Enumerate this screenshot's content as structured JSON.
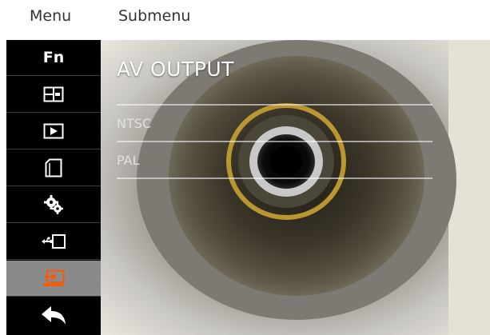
{
  "header": {
    "menu_label": "Menu",
    "submenu_label": "Submenu"
  },
  "sidebar": {
    "fn_label": "Fn",
    "items": [
      {
        "name": "fn",
        "icon": "fn-text",
        "label": "Fn"
      },
      {
        "name": "split-view",
        "icon": "split-view-icon"
      },
      {
        "name": "playback",
        "icon": "play-icon"
      },
      {
        "name": "memory-card",
        "icon": "sd-card-icon"
      },
      {
        "name": "settings",
        "icon": "gears-icon"
      },
      {
        "name": "usb",
        "icon": "usb-icon"
      },
      {
        "name": "av-output",
        "icon": "av-output-icon",
        "active": true
      },
      {
        "name": "back",
        "icon": "back-arrow-icon"
      }
    ],
    "active_color": "#ff5500"
  },
  "panel": {
    "title": "AV OUTPUT",
    "options": [
      "NTSC",
      "PAL"
    ]
  }
}
